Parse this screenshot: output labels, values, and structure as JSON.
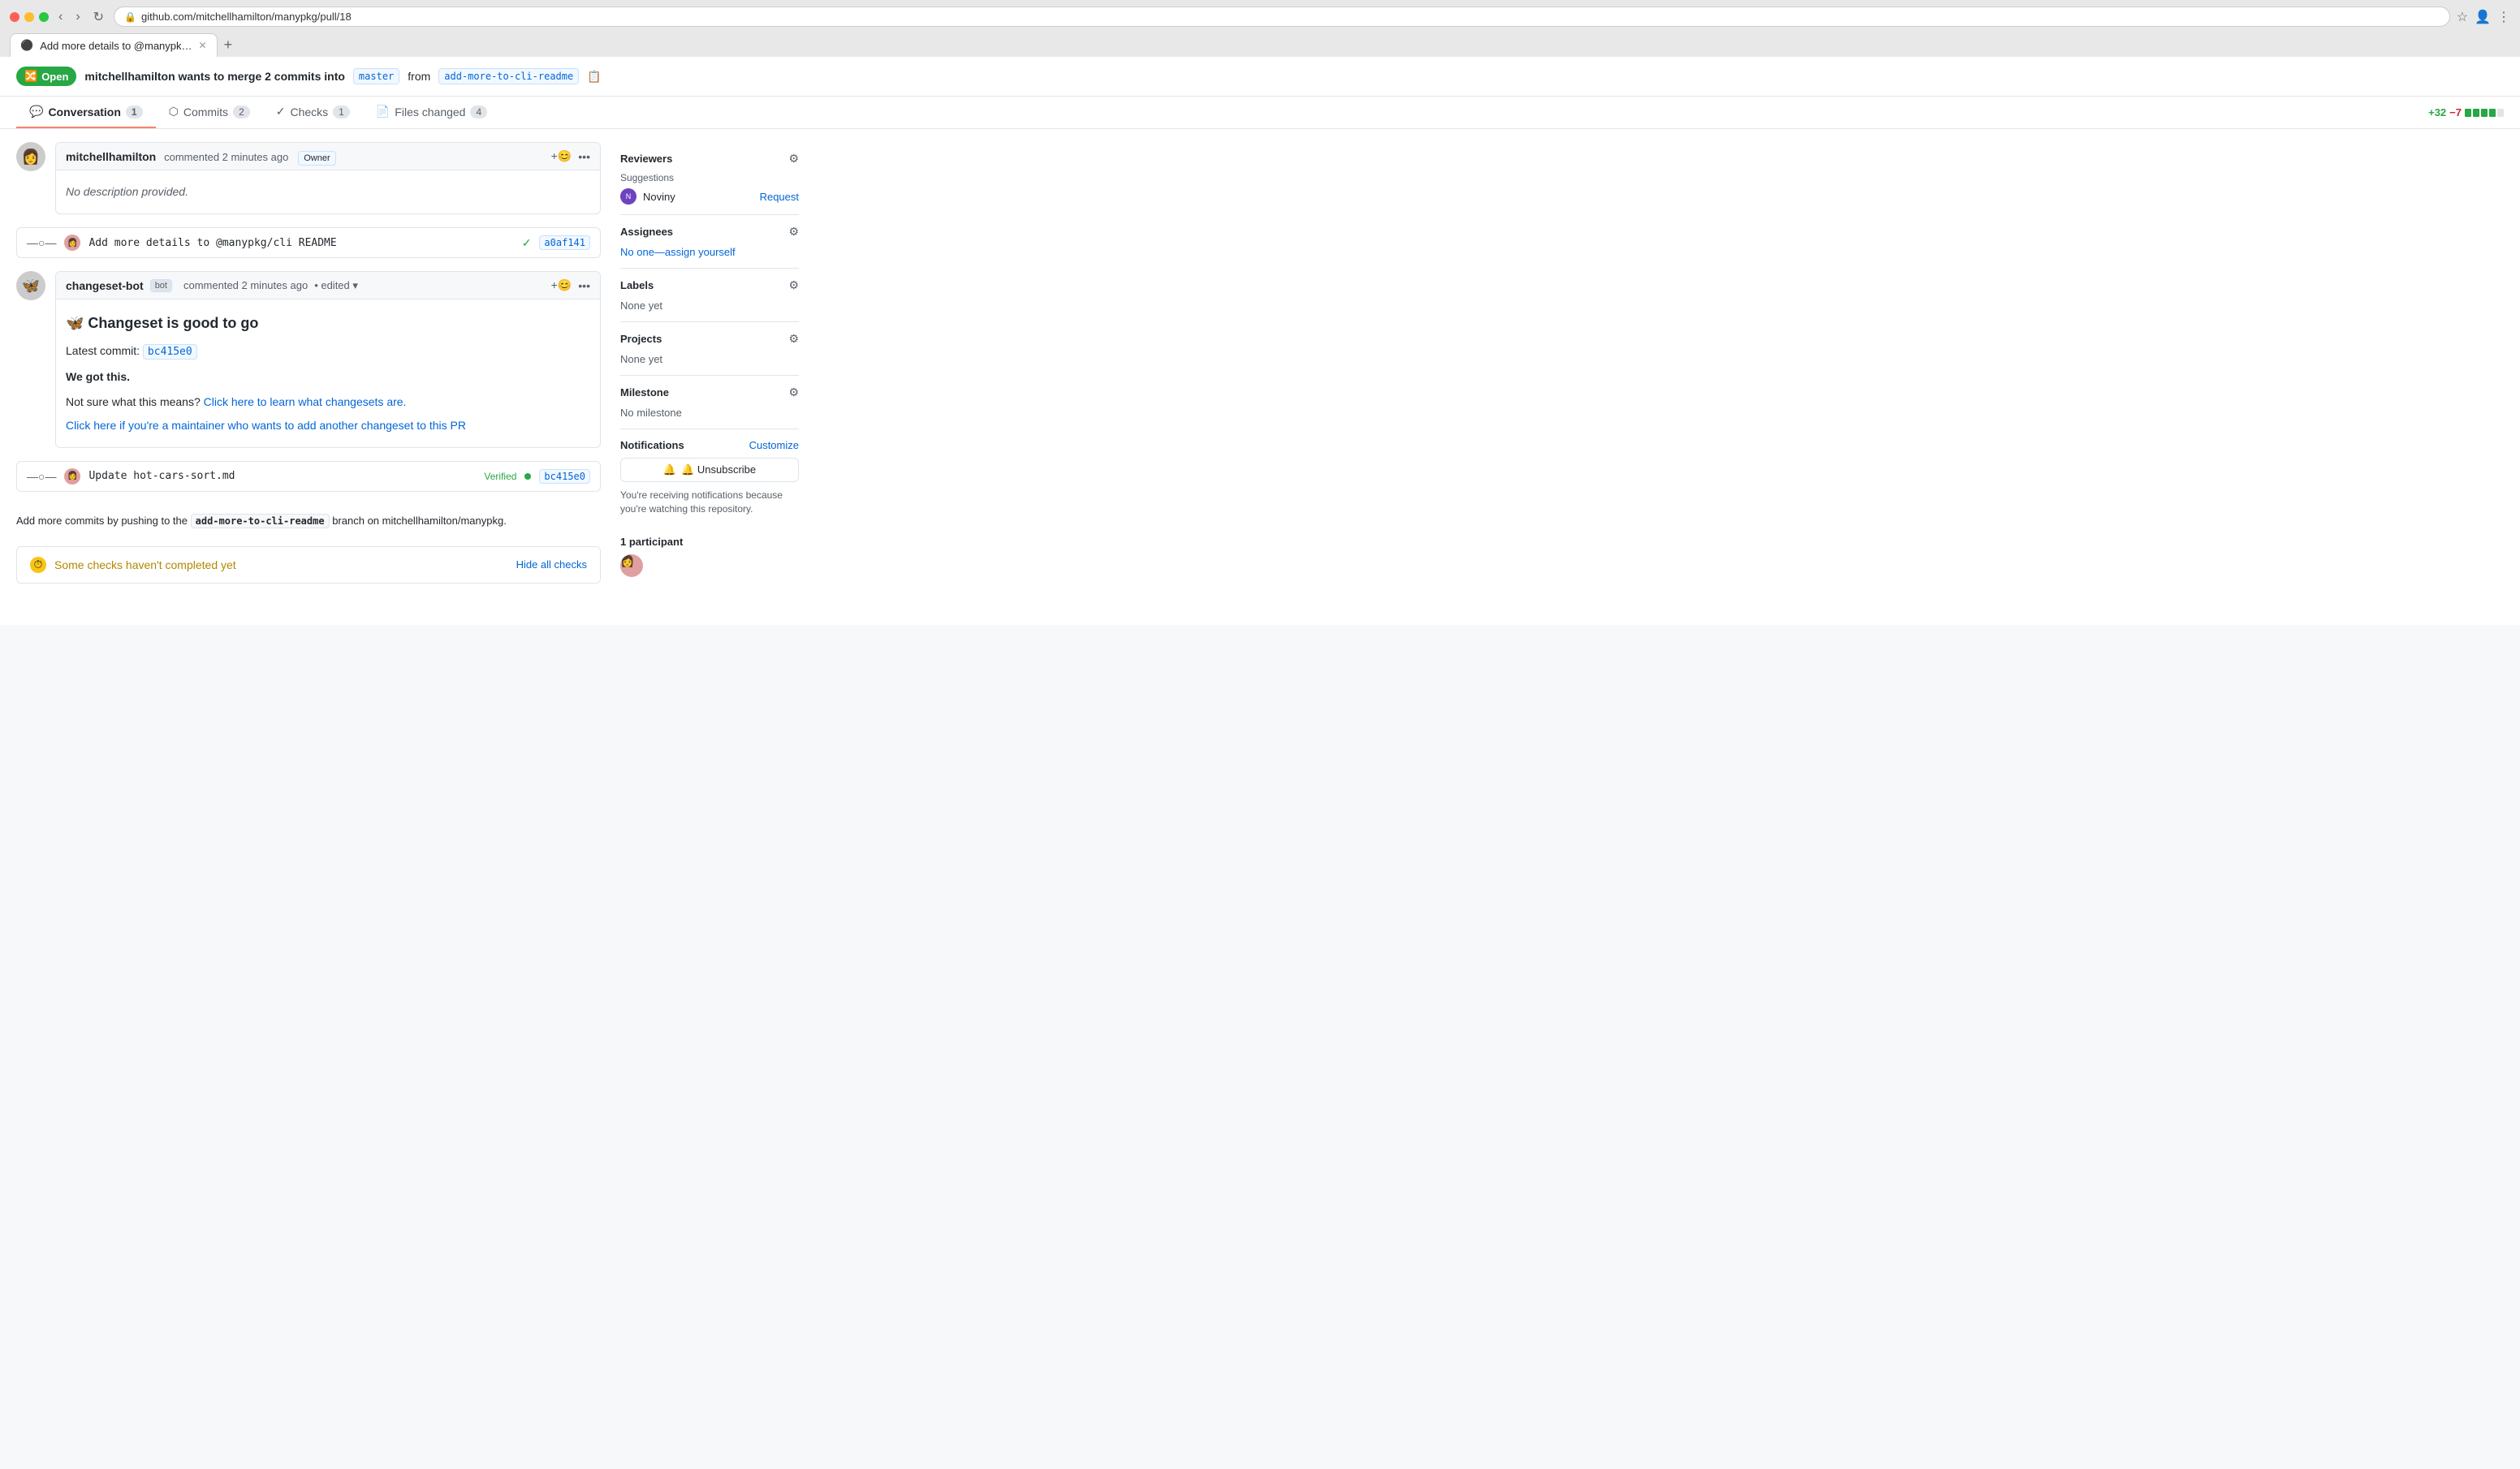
{
  "browser": {
    "tab_title": "Add more details to @manypk…",
    "url": "github.com/mitchellhamilton/manypkg/pull/18",
    "new_tab_label": "+"
  },
  "pr": {
    "status": "Open",
    "status_icon": "🔀",
    "merge_text": "mitchellhamilton wants to merge 2 commits into",
    "base_branch": "master",
    "from_text": "from",
    "head_branch": "add-more-to-cli-readme"
  },
  "tabs": [
    {
      "label": "Conversation",
      "count": "1",
      "active": true
    },
    {
      "label": "Commits",
      "count": "2",
      "active": false
    },
    {
      "label": "Checks",
      "count": "1",
      "active": false
    },
    {
      "label": "Files changed",
      "count": "4",
      "active": false
    }
  ],
  "diff_stats": {
    "add": "+32",
    "del": "−7"
  },
  "first_comment": {
    "author": "mitchellhamilton",
    "time": "commented 2 minutes ago",
    "badge": "Owner",
    "body": "No description provided.",
    "body_italic": true
  },
  "first_commit": {
    "message": "Add more details to @manypkg/cli README",
    "hash": "a0af141",
    "checkmark": "✓"
  },
  "bot_comment": {
    "author": "changeset-bot",
    "badge": "bot",
    "time": "commented 2 minutes ago",
    "edited": "• edited ▾",
    "title": "🦋 Changeset is good to go",
    "latest_commit_label": "Latest commit:",
    "latest_commit_hash": "bc415e0",
    "we_got_this": "We got this.",
    "not_sure_text": "Not sure what this means?",
    "learn_link_text": "Click here to learn what changesets are.",
    "maintainer_link_text": "Click here if you're a maintainer who wants to add another changeset to this PR"
  },
  "second_commit": {
    "message": "Update hot-cars-sort.md",
    "verified": "Verified",
    "hash": "bc415e0"
  },
  "branch_info": {
    "text": "Add more commits by pushing to the",
    "branch": "add-more-to-cli-readme",
    "suffix": "branch on mitchellhamilton/manypkg."
  },
  "checks": {
    "title": "Some checks haven't completed yet",
    "hide_label": "Hide all checks"
  },
  "sidebar": {
    "reviewers": {
      "title": "Reviewers",
      "suggestions_label": "Suggestions",
      "reviewer_name": "Noviny",
      "request_label": "Request"
    },
    "assignees": {
      "title": "Assignees",
      "value": "No one—assign yourself"
    },
    "labels": {
      "title": "Labels",
      "value": "None yet"
    },
    "projects": {
      "title": "Projects",
      "value": "None yet"
    },
    "milestone": {
      "title": "Milestone",
      "value": "No milestone"
    },
    "notifications": {
      "title": "Notifications",
      "customize_label": "Customize",
      "unsubscribe_label": "🔔 Unsubscribe",
      "watching_text": "You're receiving notifications because you're watching this repository."
    },
    "participants": {
      "title": "1 participant"
    }
  }
}
